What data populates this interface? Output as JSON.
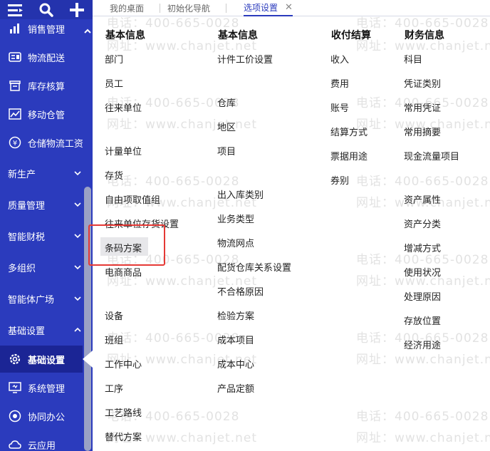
{
  "tabs": [
    {
      "label": "我的桌面"
    },
    {
      "label": "初始化导航"
    },
    {
      "label": "选项设置",
      "close": "✕"
    }
  ],
  "sidebar": {
    "subitems": [
      {
        "label": "销售管理",
        "icon": "sales-chart-icon"
      },
      {
        "label": "物流配送",
        "icon": "logistics-icon"
      },
      {
        "label": "库存核算",
        "icon": "inventory-icon"
      },
      {
        "label": "移动仓管",
        "icon": "mobile-warehouse-icon"
      },
      {
        "label": "仓储物流工资",
        "icon": "wage-icon"
      }
    ],
    "groups": [
      {
        "label": "新生产"
      },
      {
        "label": "质量管理"
      },
      {
        "label": "智能财税"
      },
      {
        "label": "多组织"
      },
      {
        "label": "智能体广场"
      },
      {
        "label": "基础设置"
      }
    ],
    "bottom_items": [
      {
        "label": "基础设置",
        "icon": "gear-icon",
        "active": true
      },
      {
        "label": "系统管理",
        "icon": "monitor-icon"
      },
      {
        "label": "协同办公",
        "icon": "collab-icon"
      },
      {
        "label": "云应用",
        "icon": "cloud-icon"
      }
    ]
  },
  "columns": [
    {
      "header": "基本信息",
      "items": [
        "部门",
        "员工",
        "往来单位",
        "计量单位",
        "存货",
        "自由项取值组",
        "往来单位存货设置",
        "条码方案",
        "电商商品",
        "设备",
        "班组",
        "工作中心",
        "工序",
        "工艺路线",
        "替代方案"
      ]
    },
    {
      "header": "基本信息",
      "items": [
        "计件工价设置",
        "仓库",
        "地区",
        "项目",
        "出入库类别",
        "业务类型",
        "物流网点",
        "配货仓库关系设置",
        "不合格原因",
        "检验方案",
        "成本项目",
        "成本中心",
        "产品定额"
      ]
    },
    {
      "header": "收付结算",
      "items": [
        "收入",
        "费用",
        "账号",
        "结算方式",
        "票据用途",
        "券别"
      ]
    },
    {
      "header": "财务信息",
      "items": [
        "科目",
        "凭证类别",
        "常用凭证",
        "常用摘要",
        "现金流量项目",
        "资产属性",
        "资产分类",
        "增减方式",
        "使用状况",
        "处理原因",
        "存放位置",
        "经济用途"
      ]
    }
  ],
  "highlighted_item": "条码方案",
  "watermark": {
    "phone": "电话：400-665-0028",
    "site": "网址：www.chanjet.net"
  }
}
